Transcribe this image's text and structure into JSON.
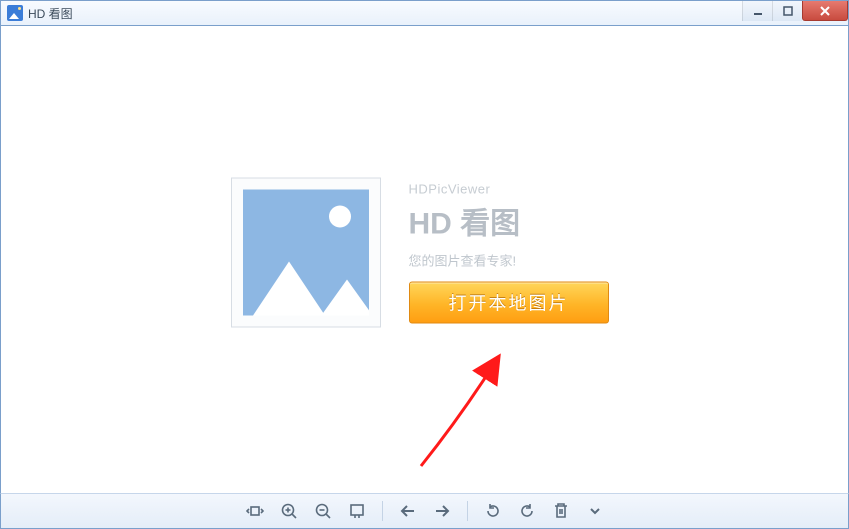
{
  "window": {
    "title": "HD 看图"
  },
  "welcome": {
    "brand_en": "HDPicViewer",
    "brand_cn": "HD 看图",
    "slogan": "您的图片查看专家!",
    "open_button": "打开本地图片"
  },
  "toolbar": {
    "fit": "适应窗口",
    "zoom_in": "放大",
    "zoom_out": "缩小",
    "actual": "实际尺寸",
    "prev": "上一张",
    "next": "下一张",
    "rotate_ccw": "逆时针旋转",
    "rotate_cw": "顺时针旋转",
    "delete": "删除",
    "more": "更多"
  }
}
